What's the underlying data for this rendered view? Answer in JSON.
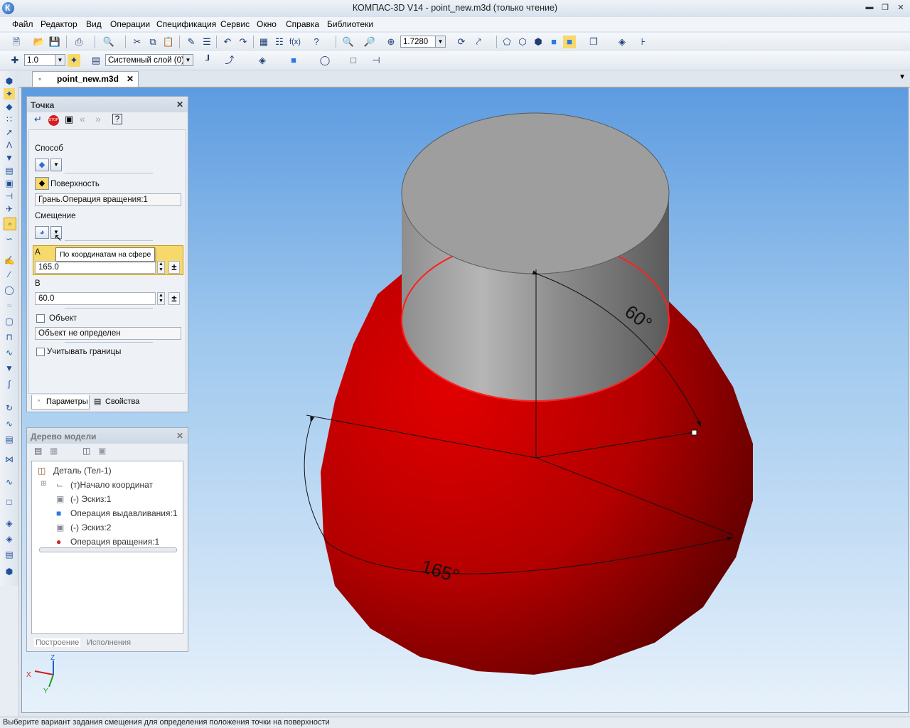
{
  "window": {
    "title": "КОМПАС-3D V14 - point_new.m3d (только чтение)"
  },
  "menu": [
    "Файл",
    "Редактор",
    "Вид",
    "Операции",
    "Спецификация",
    "Сервис",
    "Окно",
    "Справка",
    "Библиотеки"
  ],
  "toolbar1": {
    "zoom_value": "1.7280"
  },
  "toolbar2": {
    "step_value": "1.0",
    "layer_value": "Системный слой (0)"
  },
  "doc_tab": {
    "label": "point_new.m3d"
  },
  "point_panel": {
    "title": "Точка",
    "method_label": "Способ",
    "surface_button": "Поверхность",
    "surface_value": "Грань.Операция вращения:1",
    "offset_label": "Смещение",
    "tooltip": "По координатам на сфере",
    "a_label": "A",
    "a_value": "165.0",
    "b_label": "B",
    "b_value": "60.0",
    "object_label": "Объект",
    "object_value": "Объект не определен",
    "bounds_label": "Учитывать границы",
    "tab_params": "Параметры",
    "tab_props": "Свойства"
  },
  "model_tree": {
    "title": "Дерево модели",
    "items": [
      {
        "label": "Деталь (Тел-1)",
        "icon": "part-icon"
      },
      {
        "label": "(т)Начало координат",
        "icon": "origin-icon"
      },
      {
        "label": "(-) Эскиз:1",
        "icon": "sketch-icon"
      },
      {
        "label": "Операция выдавливания:1",
        "icon": "extrude-icon"
      },
      {
        "label": "(-) Эскиз:2",
        "icon": "sketch-icon"
      },
      {
        "label": "Операция вращения:1",
        "icon": "revolve-icon"
      }
    ],
    "tab_build": "Построение",
    "tab_exec": "Исполнения"
  },
  "viewport": {
    "dim_b": "60°",
    "dim_a": "165°",
    "axis_x": "X",
    "axis_y": "Y",
    "axis_z": "Z",
    "colors": {
      "sphere": "#c00000",
      "cylinder": "#9a9a9a",
      "highlight": "#ff2020"
    }
  },
  "status": "Выберите вариант задания смещения для определения положения точки на поверхности"
}
